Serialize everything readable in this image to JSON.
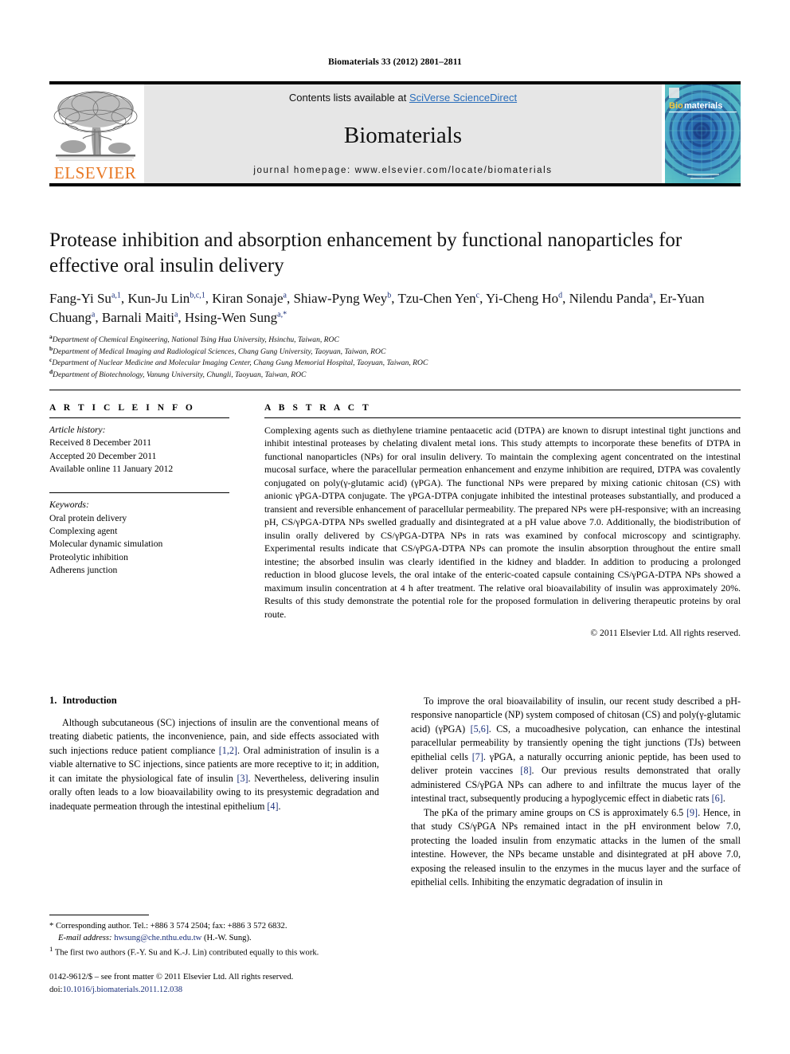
{
  "running_head": "Biomaterials 33 (2012) 2801–2811",
  "masthead": {
    "publisher_name": "ELSEVIER",
    "contents_prefix": "Contents lists available at ",
    "contents_link": "SciVerse ScienceDirect",
    "journal_name": "Biomaterials",
    "homepage": "journal homepage: www.elsevier.com/locate/biomaterials",
    "cover_title_bio": "Bio",
    "cover_title_materials": "materials"
  },
  "article": {
    "title": "Protease inhibition and absorption enhancement by functional nanoparticles for effective oral insulin delivery",
    "authors": [
      {
        "name": "Fang-Yi Su",
        "marks": "a,1",
        "sep": ", "
      },
      {
        "name": "Kun-Ju Lin",
        "marks": "b,c,1",
        "sep": ", "
      },
      {
        "name": "Kiran Sonaje",
        "marks": "a",
        "sep": ", "
      },
      {
        "name": "Shiaw-Pyng Wey",
        "marks": "b",
        "sep": ", "
      },
      {
        "name": "Tzu-Chen Yen",
        "marks": "c",
        "sep": ", "
      },
      {
        "name": "Yi-Cheng Ho",
        "marks": "d",
        "sep": ", "
      },
      {
        "name": "Nilendu Panda",
        "marks": "a",
        "sep": ", "
      },
      {
        "name": "Er-Yuan Chuang",
        "marks": "a",
        "sep": ", "
      },
      {
        "name": "Barnali Maiti",
        "marks": "a",
        "sep": ", "
      },
      {
        "name": "Hsing-Wen Sung",
        "marks": "a,*",
        "sep": ""
      }
    ],
    "affiliations": [
      {
        "mark": "a",
        "text": "Department of Chemical Engineering, National Tsing Hua University, Hsinchu, Taiwan, ROC"
      },
      {
        "mark": "b",
        "text": "Department of Medical Imaging and Radiological Sciences, Chang Gung University, Taoyuan, Taiwan, ROC"
      },
      {
        "mark": "c",
        "text": "Department of Nuclear Medicine and Molecular Imaging Center, Chang Gung Memorial Hospital, Taoyuan, Taiwan, ROC"
      },
      {
        "mark": "d",
        "text": "Department of Biotechnology, Vanung University, Chungli, Taoyuan, Taiwan, ROC"
      }
    ]
  },
  "article_info": {
    "heading": "A R T I C L E  I N F O",
    "history_title": "Article history:",
    "history": [
      "Received 8 December 2011",
      "Accepted 20 December 2011",
      "Available online 11 January 2012"
    ],
    "keywords_title": "Keywords:",
    "keywords": [
      "Oral protein delivery",
      "Complexing agent",
      "Molecular dynamic simulation",
      "Proteolytic inhibition",
      "Adherens junction"
    ]
  },
  "abstract": {
    "heading": "A B S T R A C T",
    "text": "Complexing agents such as diethylene triamine pentaacetic acid (DTPA) are known to disrupt intestinal tight junctions and inhibit intestinal proteases by chelating divalent metal ions. This study attempts to incorporate these benefits of DTPA in functional nanoparticles (NPs) for oral insulin delivery. To maintain the complexing agent concentrated on the intestinal mucosal surface, where the paracellular permeation enhancement and enzyme inhibition are required, DTPA was covalently conjugated on poly(γ-glutamic acid) (γPGA). The functional NPs were prepared by mixing cationic chitosan (CS) with anionic γPGA-DTPA conjugate. The γPGA-DTPA conjugate inhibited the intestinal proteases substantially, and produced a transient and reversible enhancement of paracellular permeability. The prepared NPs were pH-responsive; with an increasing pH, CS/γPGA-DTPA NPs swelled gradually and disintegrated at a pH value above 7.0. Additionally, the biodistribution of insulin orally delivered by CS/γPGA-DTPA NPs in rats was examined by confocal microscopy and scintigraphy. Experimental results indicate that CS/γPGA-DTPA NPs can promote the insulin absorption throughout the entire small intestine; the absorbed insulin was clearly identified in the kidney and bladder. In addition to producing a prolonged reduction in blood glucose levels, the oral intake of the enteric-coated capsule containing CS/γPGA-DTPA NPs showed a maximum insulin concentration at 4 h after treatment. The relative oral bioavailability of insulin was approximately 20%. Results of this study demonstrate the potential role for the proposed formulation in delivering therapeutic proteins by oral route.",
    "copyright": "© 2011 Elsevier Ltd. All rights reserved."
  },
  "introduction": {
    "number": "1.",
    "heading": "Introduction",
    "left_paragraphs": [
      "Although subcutaneous (SC) injections of insulin are the conventional means of treating diabetic patients, the inconvenience, pain, and side effects associated with such injections reduce patient compliance [1,2]. Oral administration of insulin is a viable alternative to SC injections, since patients are more receptive to it; in addition, it can imitate the physiological fate of insulin [3]. Nevertheless, delivering insulin orally often leads to a low bioavailability owing to its presystemic degradation and inadequate permeation through the intestinal epithelium [4]."
    ],
    "right_paragraphs": [
      "To improve the oral bioavailability of insulin, our recent study described a pH-responsive nanoparticle (NP) system composed of chitosan (CS) and poly(γ-glutamic acid) (γPGA) [5,6]. CS, a mucoadhesive polycation, can enhance the intestinal paracellular permeability by transiently opening the tight junctions (TJs) between epithelial cells [7]. γPGA, a naturally occurring anionic peptide, has been used to deliver protein vaccines [8]. Our previous results demonstrated that orally administered CS/γPGA NPs can adhere to and infiltrate the mucus layer of the intestinal tract, subsequently producing a hypoglycemic effect in diabetic rats [6].",
      "The pKa of the primary amine groups on CS is approximately 6.5 [9]. Hence, in that study CS/γPGA NPs remained intact in the pH environment below 7.0, protecting the loaded insulin from enzymatic attacks in the lumen of the small intestine. However, the NPs became unstable and disintegrated at pH above 7.0, exposing the released insulin to the enzymes in the mucus layer and the surface of epithelial cells. Inhibiting the enzymatic degradation of insulin in"
    ]
  },
  "footnotes": {
    "corresponding": "* Corresponding author. Tel.: +886 3 574 2504; fax: +886 3 572 6832.",
    "email_label": "E-mail address:",
    "email": "hwsung@che.nthu.edu.tw",
    "email_suffix": "(H.-W. Sung).",
    "equal_contrib_mark": "1",
    "equal_contrib": "The first two authors (F.-Y. Su and K.-J. Lin) contributed equally to this work."
  },
  "imprint": {
    "line1": "0142-9612/$ – see front matter © 2011 Elsevier Ltd. All rights reserved.",
    "doi_label": "doi:",
    "doi": "10.1016/j.biomaterials.2011.12.038"
  },
  "colors": {
    "elsevier_orange": "#E87722",
    "link_blue": "#2a6ebb",
    "reference_blue": "#1a2f7a",
    "banner_gray": "#e6e6e6"
  }
}
